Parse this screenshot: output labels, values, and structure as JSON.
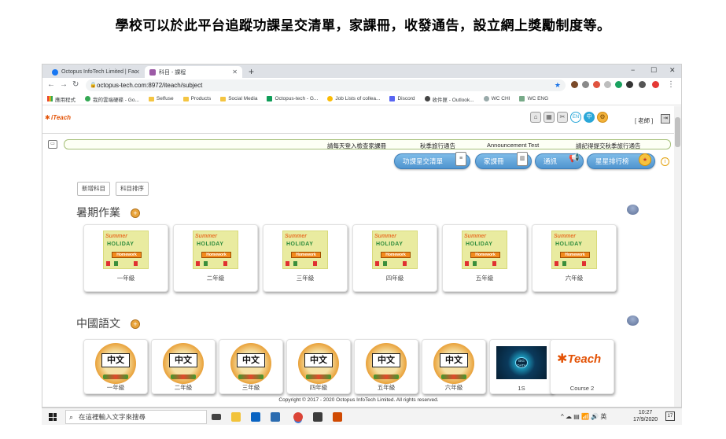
{
  "caption": "學校可以於此平台追蹤功課呈交清單，家課冊，收發通告，設立網上獎勵制度等。",
  "browser": {
    "tabs": [
      {
        "label": "Octopus InfoTech Limited | Fac"
      },
      {
        "label": "科目 - 課程"
      }
    ],
    "new_tab": "+",
    "url": "octopus-tech.com:8972/iteach/subject",
    "win_controls": {
      "minimize": "−",
      "maximize": "☐",
      "close": "✕"
    },
    "bookmarks": [
      "應用程式",
      "我的雲端硬碟 - Go...",
      "Selfuse",
      "Products",
      "Social Media",
      "Octopus-tech - G...",
      "Job Lists of collea...",
      "Discord",
      "收件匣 - Outlook...",
      "WC CHI",
      "WC ENG"
    ]
  },
  "page": {
    "logo": "iTeach",
    "lang_en": "EN",
    "lang_zh": "中",
    "user_role": "[ 老師 ]",
    "ticker": [
      "請每天登入檢查家課冊",
      "秋季旅行通告",
      "Announcement Test",
      "請記得提交秋季旅行通告"
    ],
    "nav_buttons": [
      {
        "label": "功課呈交清單"
      },
      {
        "label": "家課冊"
      },
      {
        "label": "通訊"
      },
      {
        "label": "星星排行榜"
      }
    ],
    "add_subject": "新增科目",
    "sort_subject": "科目排序",
    "sections": [
      {
        "title": "暑期作業",
        "cards": [
          "一年級",
          "二年級",
          "三年級",
          "四年級",
          "五年級",
          "六年級"
        ],
        "thumb": {
          "l1": "Summer",
          "l2": "HOLIDAY",
          "l3": "Homework"
        }
      },
      {
        "title": "中國語文",
        "cards": [
          "一年級",
          "二年級",
          "三年級",
          "四年級",
          "五年級",
          "六年級",
          "1S",
          "Course 2"
        ],
        "thumb": {
          "zh": "中文",
          "bd": "BIG DATA",
          "brand": "Teach"
        }
      }
    ],
    "footer": "Copyright © 2017 - 2020 Octopus InfoTech Limited. All rights reserved."
  },
  "taskbar": {
    "search_placeholder": "在這裡輸入文字來搜尋",
    "tray": "^ ☁ ▤ 📶 🔊 英",
    "time": "10:27",
    "date": "17/9/2020",
    "notif_count": "17"
  },
  "colors": {
    "accent": "#4f94cf",
    "brand": "#e35205",
    "ticker_border": "#a6c07a"
  }
}
